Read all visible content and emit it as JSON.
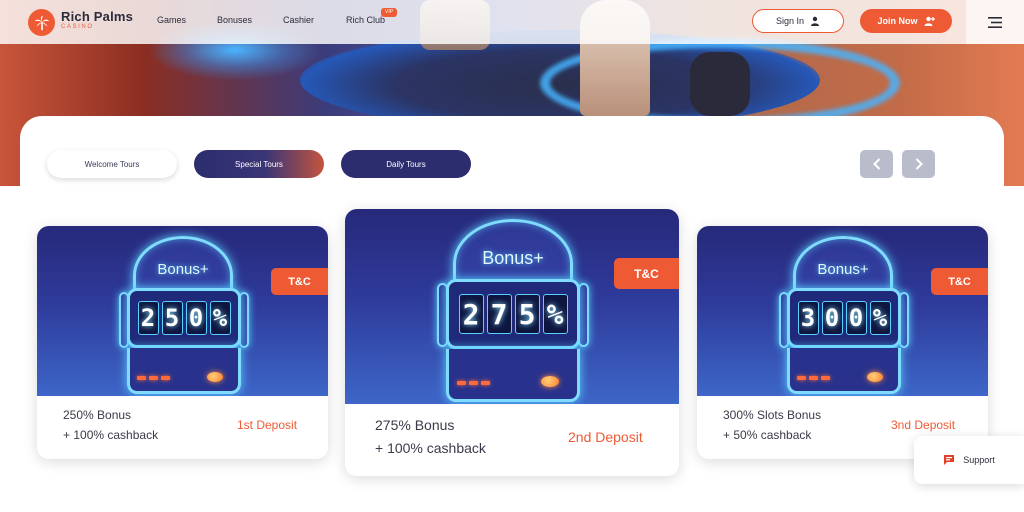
{
  "brand": {
    "name": "Rich Palms",
    "sub": "CASINO"
  },
  "nav": {
    "items": [
      "Games",
      "Bonuses",
      "Cashier",
      "Rich Club"
    ],
    "vip_badge": "VIP",
    "signin_label": "Sign In",
    "join_label": "Join Now"
  },
  "tabs": {
    "welcome": "Welcome Tours",
    "special": "Special Tours",
    "daily": "Daily Tours"
  },
  "cards": [
    {
      "arch": "Bonus+",
      "digits": [
        "2",
        "5",
        "0",
        "%"
      ],
      "tc": "T&C",
      "line1": "250% Bonus",
      "line2": "+ 100% cashback",
      "deposit": "1st Deposit"
    },
    {
      "arch": "Bonus+",
      "digits": [
        "2",
        "7",
        "5",
        "%"
      ],
      "tc": "T&C",
      "line1": "275% Bonus",
      "line2": "+ 100% cashback",
      "deposit": "2nd Deposit"
    },
    {
      "arch": "Bonus+",
      "digits": [
        "3",
        "0",
        "0",
        "%"
      ],
      "tc": "T&C",
      "line1": "300% Slots Bonus",
      "line2": "+ 50% cashback",
      "deposit": "3nd Deposit"
    }
  ],
  "support": {
    "label": "Support"
  },
  "colors": {
    "accent": "#ee5a34",
    "navy": "#2b2d6e"
  },
  "icons": {
    "logo": "palm-icon",
    "signin": "user-icon",
    "join": "user-plus-icon",
    "menu": "hamburger-icon",
    "prev": "chevron-left-icon",
    "next": "chevron-right-icon",
    "support": "chat-icon"
  }
}
